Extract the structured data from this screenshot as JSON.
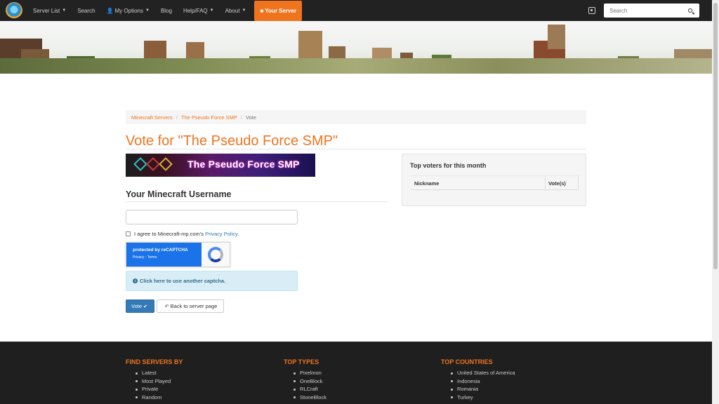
{
  "navbar": {
    "items": [
      {
        "label": "Server List",
        "has_caret": true
      },
      {
        "label": "Search",
        "has_caret": false
      },
      {
        "label": "My Options",
        "has_caret": true
      },
      {
        "label": "Blog",
        "has_caret": false
      },
      {
        "label": "Help/FAQ",
        "has_caret": true
      },
      {
        "label": "About",
        "has_caret": true
      }
    ],
    "your_server": "Your Server",
    "search_placeholder": "Search"
  },
  "breadcrumb": {
    "items": [
      "Minecraft Servers",
      "The Pseudo Force SMP"
    ],
    "active": "Vote"
  },
  "page_title": "Vote for \"The Pseudo Force SMP\"",
  "server_banner_text": "The Pseudo Force SMP",
  "username_section": {
    "title": "Your Minecraft Username",
    "input_value": "",
    "agree_text": "I agree to Minecraft-mp.com's",
    "privacy_link": "Privacy Policy",
    "agree_suffix": "."
  },
  "recaptcha": {
    "protected_by": "protected by reCAPTCHA",
    "links": "Privacy - Terms"
  },
  "captcha_alert": "Click here to use another captcha.",
  "buttons": {
    "vote": "Vote",
    "back": "Back to server page"
  },
  "top_voters": {
    "title": "Top voters for this month",
    "columns": [
      "Nickname",
      "Vote(s)"
    ]
  },
  "footer": {
    "columns": [
      {
        "heading": "FIND SERVERS BY",
        "items": [
          "Latest",
          "Most Played",
          "Private",
          "Random"
        ]
      },
      {
        "heading": "TOP TYPES",
        "items": [
          "Pixelmon",
          "OneBlock",
          "RLCraft",
          "StoneBlock"
        ]
      },
      {
        "heading": "TOP COUNTRIES",
        "items": [
          "United States of America",
          "Indonesia",
          "Romania",
          "Turkey"
        ]
      }
    ]
  },
  "colors": {
    "accent": "#f0741e",
    "navbar": "#222222",
    "primary": "#337ab7",
    "footer": "#1f1f1f"
  }
}
